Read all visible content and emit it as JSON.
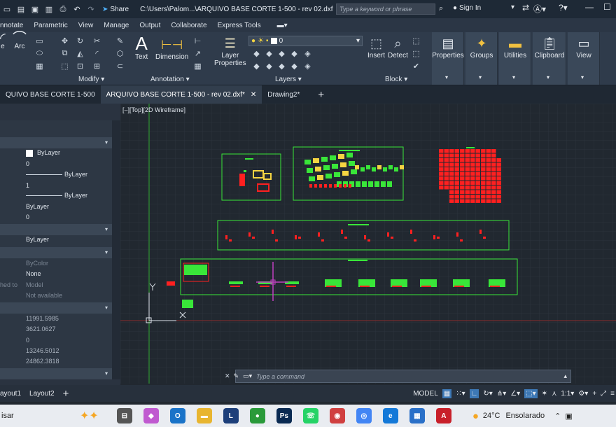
{
  "titlebar": {
    "share_label": "Share",
    "file_path": "C:\\Users\\Palom...\\ARQUIVO BASE CORTE 1-500  -  rev 02.dxf",
    "search_placeholder": "Type a keyword or phrase",
    "sign_in": "Sign In"
  },
  "menu": [
    "nnotate",
    "Parametric",
    "View",
    "Manage",
    "Output",
    "Collaborate",
    "Express Tools"
  ],
  "ribbon": {
    "draw": {
      "arc": "Arc",
      "line": "e"
    },
    "modify_label": "Modify",
    "annotation": {
      "text": "Text",
      "dimension": "Dimension",
      "label": "Annotation"
    },
    "layers": {
      "layer_properties_1": "Layer",
      "layer_properties_2": "Properties",
      "current_layer": "0",
      "label": "Layers"
    },
    "block": {
      "insert": "Insert",
      "detect": "Detect",
      "label": "Block"
    },
    "properties": "Properties",
    "groups": "Groups",
    "utilities": "Utilities",
    "clipboard": "Clipboard",
    "view": "View"
  },
  "tabs": [
    {
      "label": "QUIVO BASE CORTE 1-500",
      "active": false,
      "closable": false
    },
    {
      "label": "ARQUIVO BASE CORTE 1-500  -  rev 02.dxf*",
      "active": true,
      "closable": true
    },
    {
      "label": "Drawing2*",
      "active": false,
      "closable": false
    }
  ],
  "viewport_label": "[–][Top][2D Wireframe]",
  "properties_panel": {
    "general": [
      {
        "value": "ByLayer",
        "swatch": true
      },
      {
        "value": "0"
      },
      {
        "value": "ByLayer",
        "line": true
      },
      {
        "value": "1"
      },
      {
        "value": "ByLayer",
        "line": true
      },
      {
        "value": "ByLayer"
      },
      {
        "value": "0"
      }
    ],
    "third_d": [
      {
        "value": "ByLayer"
      }
    ],
    "plot": [
      {
        "label": "",
        "value": "ByColor",
        "dim": true
      },
      {
        "label": "",
        "value": "None",
        "dim": false
      },
      {
        "label": "hed to",
        "value": "Model",
        "dim": true
      },
      {
        "label": "",
        "value": "Not available",
        "dim": true
      }
    ],
    "view": [
      "11991.5985",
      "3621.0627",
      "0",
      "13246.5012",
      "24862.3818"
    ]
  },
  "command_placeholder": "Type a command",
  "layout_tabs": [
    "ayout1",
    "Layout2"
  ],
  "status": {
    "model": "MODEL",
    "scale": "1:1"
  },
  "taskbar": {
    "search": "isar",
    "weather_temp": "24°C",
    "weather_desc": "Ensolarado"
  },
  "colors": {
    "accent_green": "#39e639",
    "accent_red": "#ff2020",
    "viewport_bg": "#212830"
  }
}
